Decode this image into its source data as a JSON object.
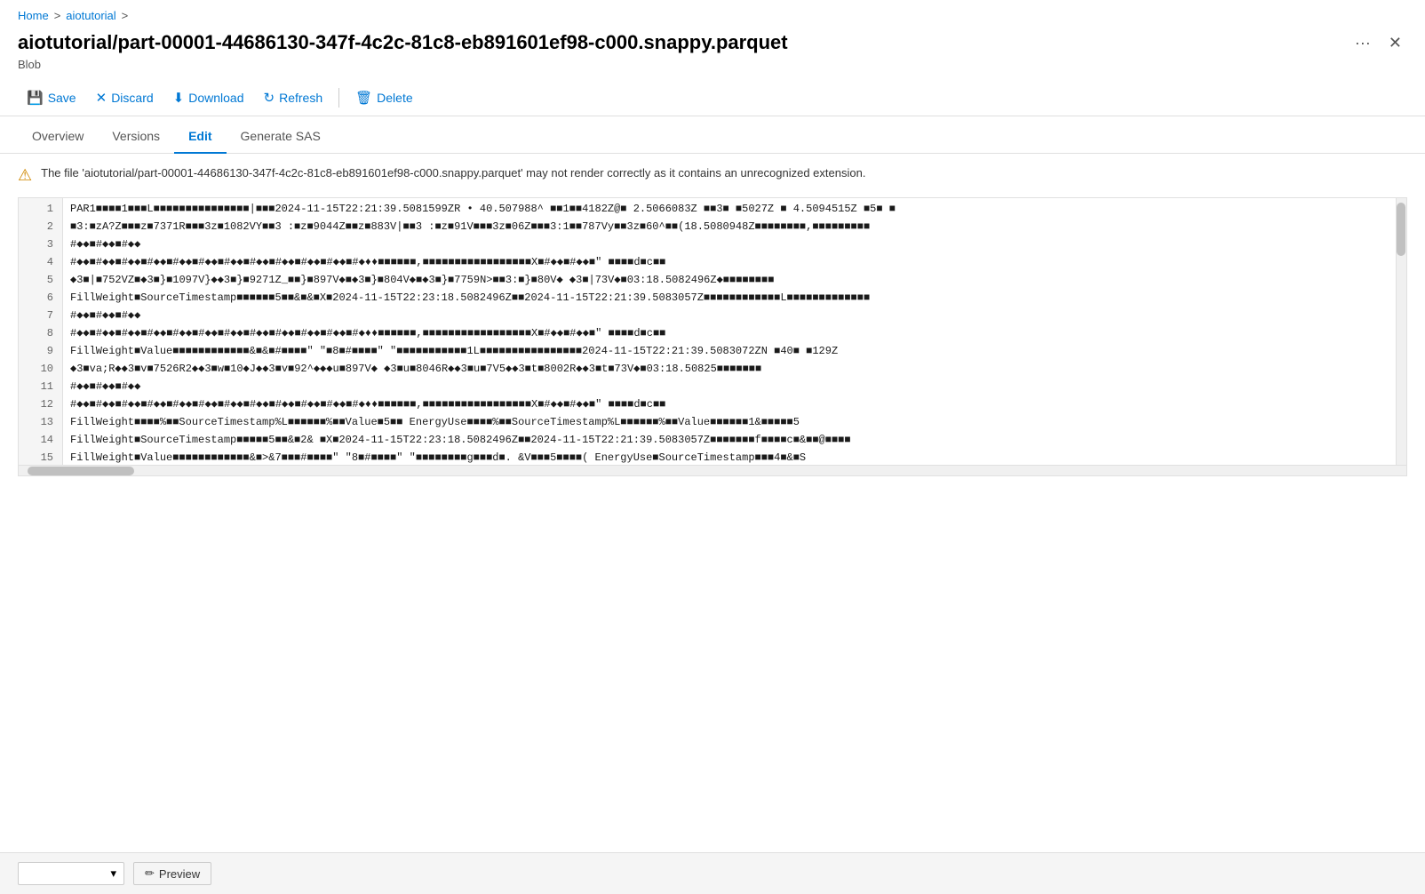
{
  "breadcrumb": {
    "home": "Home",
    "separator1": ">",
    "tutorial": "aiotutorial",
    "separator2": ">"
  },
  "title": "aiotutorial/part-00001-44686130-347f-4c2c-81c8-eb891601ef98-c000.snappy.parquet",
  "blob_label": "Blob",
  "toolbar": {
    "save": "Save",
    "discard": "Discard",
    "download": "Download",
    "refresh": "Refresh",
    "delete": "Delete"
  },
  "tabs": [
    {
      "id": "overview",
      "label": "Overview"
    },
    {
      "id": "versions",
      "label": "Versions"
    },
    {
      "id": "edit",
      "label": "Edit",
      "active": true
    },
    {
      "id": "generate-sas",
      "label": "Generate SAS"
    }
  ],
  "warning": "The file 'aiotutorial/part-00001-44686130-347f-4c2c-81c8-eb891601ef98-c000.snappy.parquet' may not render correctly as it contains an unrecognized extension.",
  "lines": [
    {
      "num": 1,
      "content": "PAR1■■■■1■■■L■■■■■■■■■■■■■■■|■■■2024-11-15T22:21:39.5081599ZR • 40.507988^ ■■1■■4182Z@■ 2.5066083Z ■■3■ ■5027Z ■ 4.5094515Z ■5■ ■"
    },
    {
      "num": 2,
      "content": "■3:■zA?Z■■■z■7371R■■■3z■1082VY■■3 :■z■9044Z■■z■883V|■■3 :■z■91V■■■3z■06Z■■■3:1■■787Vy■■3z■60^■■(18.5080948Z■■■■■■■■,■■■■■■■■■"
    },
    {
      "num": 3,
      "content": "#◆◆■#◆◆■#◆◆"
    },
    {
      "num": 4,
      "content": "#◆◆■#◆◆■#◆◆■#◆◆■#◆◆■#◆◆■#◆◆■#◆◆■#◆◆■#◆◆■#◆◆■#◆♦♦■■■■■■,■■■■■■■■■■■■■■■■■X■#◆◆■#◆◆■\"  ■■■■d■c■■"
    },
    {
      "num": 5,
      "content": "◆3■|■752VZ■◆3■}■1097V}◆◆3■}■9271Z_■■}■897V◆■◆3■}■804V◆■◆3■}■7759N>■■3:■}■80V◆  ◆3■|73V◆■03:18.5082496Z◆■■■■■■■■"
    },
    {
      "num": 6,
      "content": "FillWeight■SourceTimestamp■■■■■■5■■&■&■X■2024-11-15T22:23:18.5082496Z■■2024-11-15T22:21:39.5083057Z■■■■■■■■■■■■L■■■■■■■■■■■■■"
    },
    {
      "num": 7,
      "content": "#◆◆■#◆◆■#◆◆"
    },
    {
      "num": 8,
      "content": "#◆◆■#◆◆■#◆◆■#◆◆■#◆◆■#◆◆■#◆◆■#◆◆■#◆◆■#◆◆■#◆◆■#◆♦♦■■■■■■,■■■■■■■■■■■■■■■■■X■#◆◆■#◆◆■\"  ■■■■d■c■■"
    },
    {
      "num": 9,
      "content": "FillWeight■Value■■■■■■■■■■■■&■&■#■■■■\"  \"■8■#■■■■\"  \"■■■■■■■■■■■1L■■■■■■■■■■■■■■■■2024-11-15T22:21:39.5083072ZN ■40■ ■129Z"
    },
    {
      "num": 10,
      "content": "◆3■va;R◆◆3■v■7526R2◆◆3■w■10◆J◆◆3■v■92^◆◆◆u■897V◆  ◆3■u■8046R◆◆3■u■7V5◆◆3■t■8002R◆◆3■t■73V◆■03:18.50825■■■■■■■"
    },
    {
      "num": 11,
      "content": "#◆◆■#◆◆■#◆◆"
    },
    {
      "num": 12,
      "content": "#◆◆■#◆◆■#◆◆■#◆◆■#◆◆■#◆◆■#◆◆■#◆◆■#◆◆■#◆◆■#◆◆■#◆♦♦■■■■■■,■■■■■■■■■■■■■■■■■X■#◆◆■#◆◆■\"  ■■■■d■c■■"
    },
    {
      "num": 13,
      "content": "FillWeight■■■■%■■SourceTimestamp%L■■■■■■%■■Value■5■■     EnergyUse■■■■%■■SourceTimestamp%L■■■■■■%■■Value■■■■■■1&■■■■■5"
    },
    {
      "num": 14,
      "content": "FillWeight■SourceTimestamp■■■■■5■■&■2&  ■X■2024-11-15T22:23:18.5082496Z■■2024-11-15T22:21:39.5083057Z■■■■■■■f■■■■c■&■■@■■■■"
    },
    {
      "num": 15,
      "content": "FillWeight■Value■■■■■■■■■■■■&■>&7■■■#■■■■\"  \"8■#■■■■\"  \"■■■■■■■■g■■■d■. &V■■■5■■■■(  EnergyUse■SourceTimestamp■■■4■&■S"
    }
  ],
  "bottom_bar": {
    "encoding_placeholder": "",
    "preview_label": "Preview",
    "preview_icon": "✏"
  }
}
